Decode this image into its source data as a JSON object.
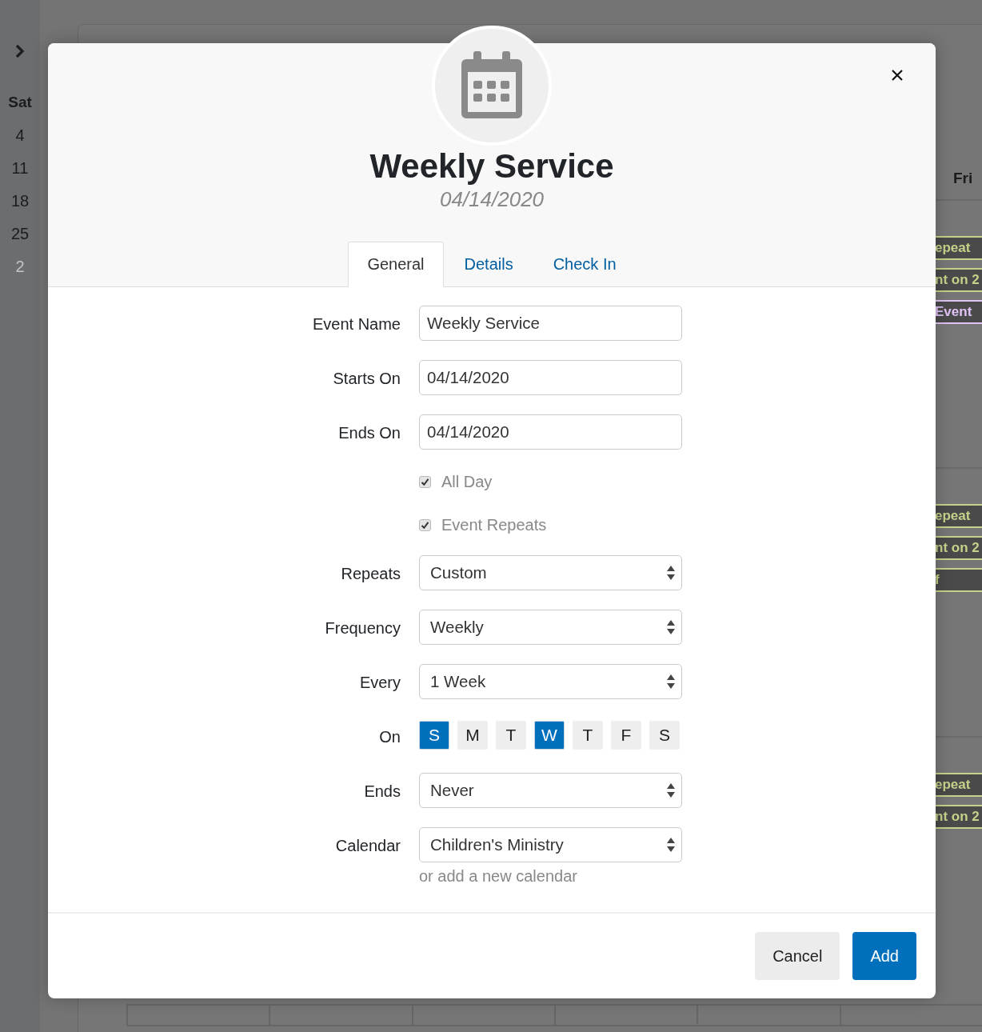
{
  "background": {
    "left_column": {
      "heading": "Sat",
      "dates": [
        {
          "text": "4",
          "muted": false
        },
        {
          "text": "11",
          "muted": false
        },
        {
          "text": "18",
          "muted": false
        },
        {
          "text": "25",
          "muted": false
        },
        {
          "text": "2",
          "muted": true
        }
      ]
    },
    "right_column": {
      "heading": "Fri",
      "weeks": [
        {
          "events": [
            {
              "text": "epeat",
              "color": "#c4d28a"
            },
            {
              "text": "nt on 2",
              "color": "#c4d28a"
            },
            {
              "text": "Event",
              "color": "#e0c2f5"
            }
          ]
        },
        {
          "events": [
            {
              "text": "epeat",
              "color": "#c4d28a"
            },
            {
              "text": "nt on 2",
              "color": "#c4d28a"
            },
            {
              "text": "f",
              "color": "#c4d28a"
            }
          ]
        },
        {
          "events": [
            {
              "text": "epeat",
              "color": "#c4d28a"
            },
            {
              "text": "nt on 2",
              "color": "#c4d28a"
            }
          ]
        }
      ]
    }
  },
  "dialog": {
    "title": "Weekly Service",
    "subtitle": "04/14/2020",
    "tabs": [
      {
        "label": "General",
        "selected": true
      },
      {
        "label": "Details",
        "selected": false
      },
      {
        "label": "Check In",
        "selected": false
      }
    ],
    "fields": [
      {
        "kind": "text",
        "label": "Event Name",
        "value": "Weekly Service"
      },
      {
        "kind": "text",
        "label": "Starts On",
        "value": "04/14/2020"
      },
      {
        "kind": "text",
        "label": "Ends On",
        "value": "04/14/2020"
      },
      {
        "kind": "checkbox",
        "label": "All Day",
        "checked": true
      },
      {
        "kind": "checkbox",
        "label": "Event Repeats",
        "checked": true
      },
      {
        "kind": "select",
        "label": "Repeats",
        "value": "Custom"
      },
      {
        "kind": "select",
        "label": "Frequency",
        "value": "Weekly"
      },
      {
        "kind": "select",
        "label": "Every",
        "value": "1 Week"
      },
      {
        "kind": "days",
        "label": "On",
        "days": [
          {
            "text": "S",
            "selected": true
          },
          {
            "text": "M",
            "selected": false
          },
          {
            "text": "T",
            "selected": false
          },
          {
            "text": "W",
            "selected": true
          },
          {
            "text": "T",
            "selected": false
          },
          {
            "text": "F",
            "selected": false
          },
          {
            "text": "S",
            "selected": false
          }
        ]
      },
      {
        "kind": "select",
        "label": "Ends",
        "value": "Never"
      },
      {
        "kind": "select",
        "label": "Calendar",
        "value": "Children's Ministry",
        "hint": "or add a new calendar"
      }
    ],
    "buttons": [
      {
        "kind": "secondary",
        "label": "Cancel"
      },
      {
        "kind": "primary",
        "label": "Add"
      }
    ]
  }
}
